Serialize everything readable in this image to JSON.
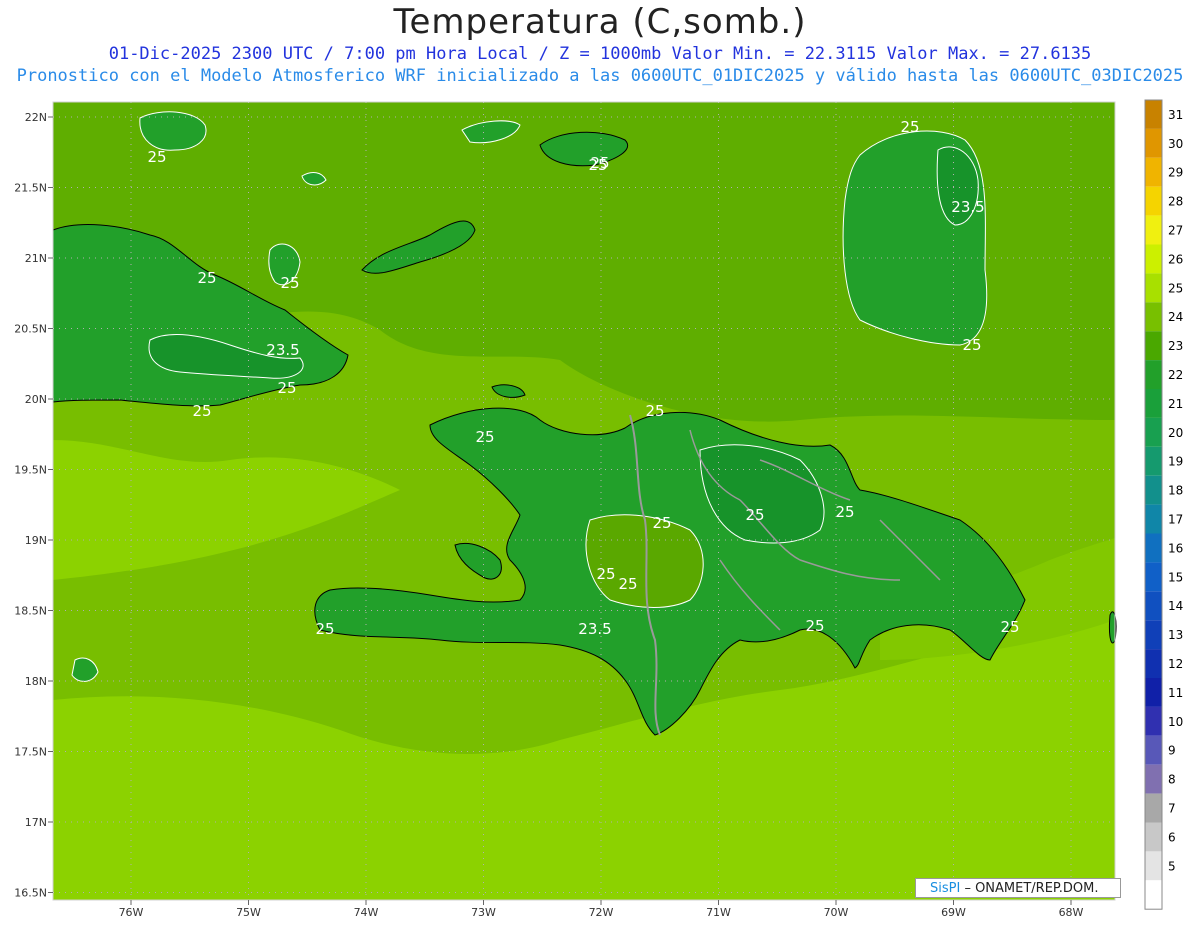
{
  "header": {
    "title": "Temperatura (C,somb.)",
    "line1": "01-Dic-2025  2300 UTC / 7:00 pm Hora Local / Z = 1000mb   Valor Min. = 22.3115  Valor Max. = 27.6135",
    "line2": "Pronostico con el Modelo Atmosferico WRF inicializado a las 0600UTC_01DIC2025 y válido hasta las  0600UTC_03DIC2025"
  },
  "axes": {
    "lat_labels": [
      "22N",
      "21.5N",
      "21N",
      "20.5N",
      "20N",
      "19.5N",
      "19N",
      "18.5N",
      "18N",
      "17.5N",
      "17N",
      "16.5N"
    ],
    "lon_labels": [
      "76W",
      "75W",
      "74W",
      "73W",
      "72W",
      "71W",
      "70W",
      "69W",
      "68W"
    ]
  },
  "contour_labels": [
    "25",
    "25",
    "25",
    "25",
    "23.5",
    "25",
    "25",
    "25",
    "25",
    "25",
    "25",
    "23.5",
    "25",
    "25",
    "25",
    "25",
    "25",
    "25",
    "23.5",
    "25",
    "25",
    "25"
  ],
  "colorbar": {
    "labels": [
      "31",
      "30",
      "29",
      "28",
      "27",
      "26",
      "25",
      "24",
      "23",
      "22",
      "21",
      "20",
      "19",
      "18",
      "17",
      "16",
      "15",
      "14",
      "13",
      "12",
      "11",
      "10",
      "9",
      "8",
      "7",
      "6",
      "5"
    ],
    "colors": [
      "#c88200",
      "#e09600",
      "#f0b400",
      "#f5d400",
      "#f0f010",
      "#ccf000",
      "#a8e000",
      "#78c000",
      "#4aa800",
      "#22a02a",
      "#1aa03a",
      "#18a050",
      "#159a6e",
      "#12908c",
      "#1086a8",
      "#1070c0",
      "#1060c8",
      "#1050c0",
      "#1040b8",
      "#1030b0",
      "#1020a8",
      "#3030b0",
      "#5858b8",
      "#8070b0",
      "#a8a8a8",
      "#c8c8c8",
      "#e4e4e4",
      "#ffffff"
    ]
  },
  "credit": {
    "brand": "SisPI",
    "text": " – ONAMET/REP.DOM."
  },
  "colors": {
    "sea_light": "#8cd200",
    "sea_mid": "#78be00",
    "land_high": "#5aa800",
    "land_cool": "#1f9a2e",
    "land_cooler": "#16922a"
  }
}
